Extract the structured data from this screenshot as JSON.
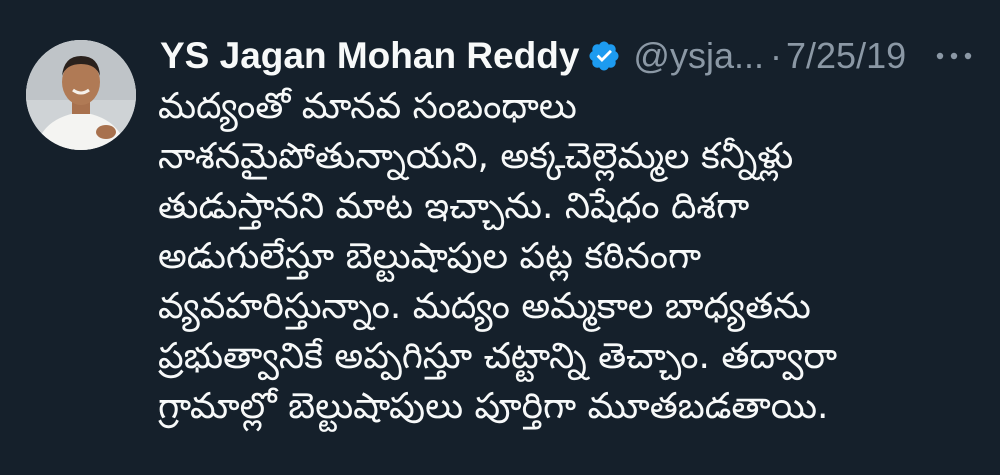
{
  "tweet": {
    "author_name": "YS Jagan Mohan Reddy",
    "handle": "@ysja...",
    "separator": "·",
    "date": "7/25/19",
    "lines": [
      "మద్యంతో మానవ సంబంధాలు",
      "నాశనమైపోతున్నాయని, అక్కచెల్లెమ్మల కన్నీళ్లు",
      "తుడుస్తానని మాట ఇచ్చాను. నిషేధం దిశగా",
      "అడుగులేస్తూ బెల్టుషాపుల పట్ల కఠినంగా",
      "వ్యవహరిస్తున్నాం. మద్యం అమ్మకాల బాధ్యతను",
      "ప్రభుత్వానికే అప్పగిస్తూ చట్టాన్ని తెచ్చాం. తద్వారా",
      "గ్రామాల్లో బెల్టుషాపులు పూర్తిగా మూతబడతాయి."
    ]
  },
  "icons": {
    "verified": "verified-badge-icon",
    "more": "more-options-icon"
  },
  "colors": {
    "background": "#15202b",
    "text": "#f7f9f9",
    "secondary_text": "#8b98a5",
    "verified_blue": "#1d9bf0"
  }
}
